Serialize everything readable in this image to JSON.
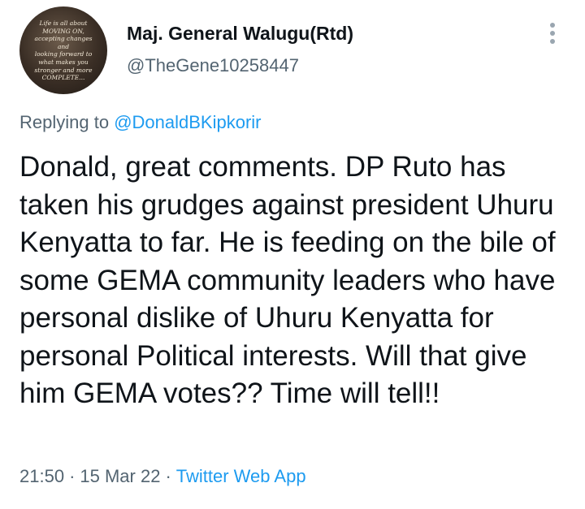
{
  "author": {
    "display_name": "Maj. General Walugu(Rtd)",
    "handle": "@TheGene10258447",
    "avatar_text": "Life is all about\nMOVING ON,\naccepting changes\nand\nlooking forward to\nwhat makes you\nstronger and more\nCOMPLETE..."
  },
  "more_icon": "more-vertical-icon",
  "reply": {
    "prefix": "Replying to ",
    "mention": "@DonaldBKipkorir"
  },
  "tweet": {
    "text": "Donald, great comments. DP Ruto has taken his grudges against president Uhuru Kenyatta to far. He is feeding on the bile of some GEMA community leaders who have personal dislike of Uhuru Kenyatta for personal Political interests. Will that give him GEMA votes?? Time will tell!!"
  },
  "meta": {
    "time": "21:50",
    "separator": "·",
    "date": "15 Mar 22",
    "source": "Twitter Web App"
  },
  "colors": {
    "text": "#0f1419",
    "secondary": "#536471",
    "link": "#1d9bf0"
  }
}
